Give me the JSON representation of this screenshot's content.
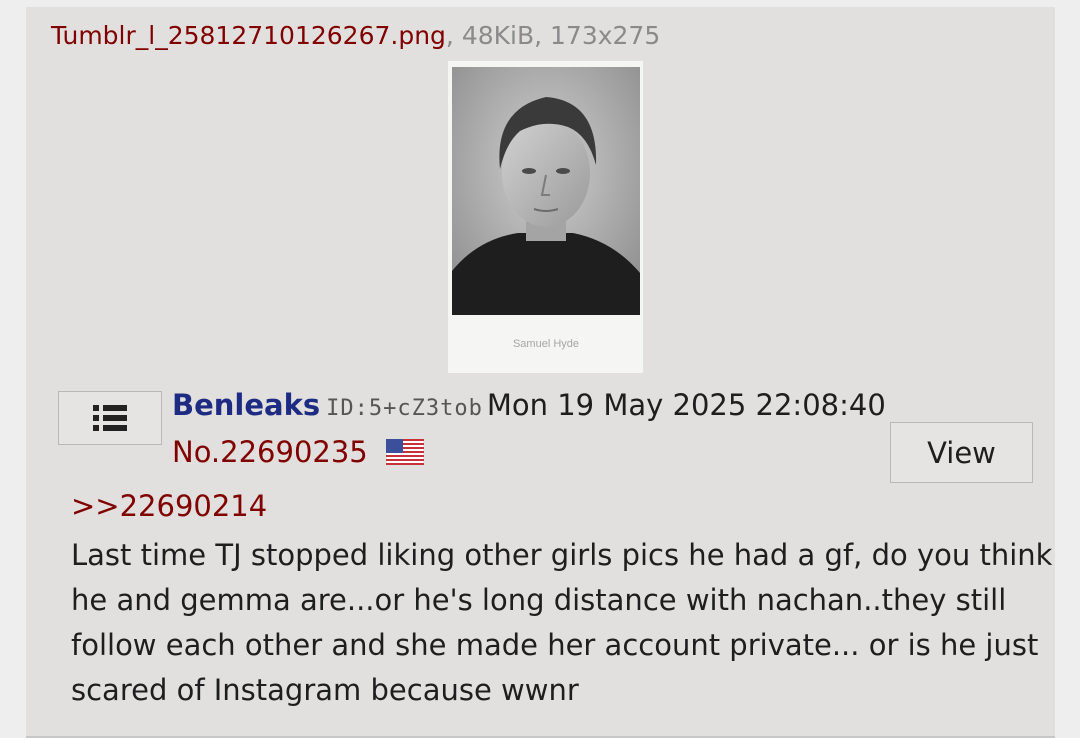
{
  "post": {
    "file": {
      "name": "Tumblr_l_25812710126267.png",
      "meta": ", 48KiB, 173x275",
      "caption_in_image": "Samuel Hyde"
    },
    "menu_icon": "list-icon",
    "name": "Benleaks",
    "id_label": "ID:5+cZ3tob",
    "datetime": "Mon 19 May 2025 22:08:40",
    "number": "No.22690235",
    "flag_icon": "us-flag-icon",
    "view_label": "View",
    "quote": ">>22690214",
    "comment_lines": [
      "Last time TJ stopped liking other girls pics he had a gf, do you think",
      "he and gemma are...or he's long distance with nachan..they still",
      "follow each other and she made her account private... or is he just",
      "scared of Instagram because wwnr"
    ]
  },
  "colors": {
    "post_bg": "#e2e0df",
    "name": "#1e2b82",
    "link": "#800000",
    "text": "#1e1e1e"
  }
}
